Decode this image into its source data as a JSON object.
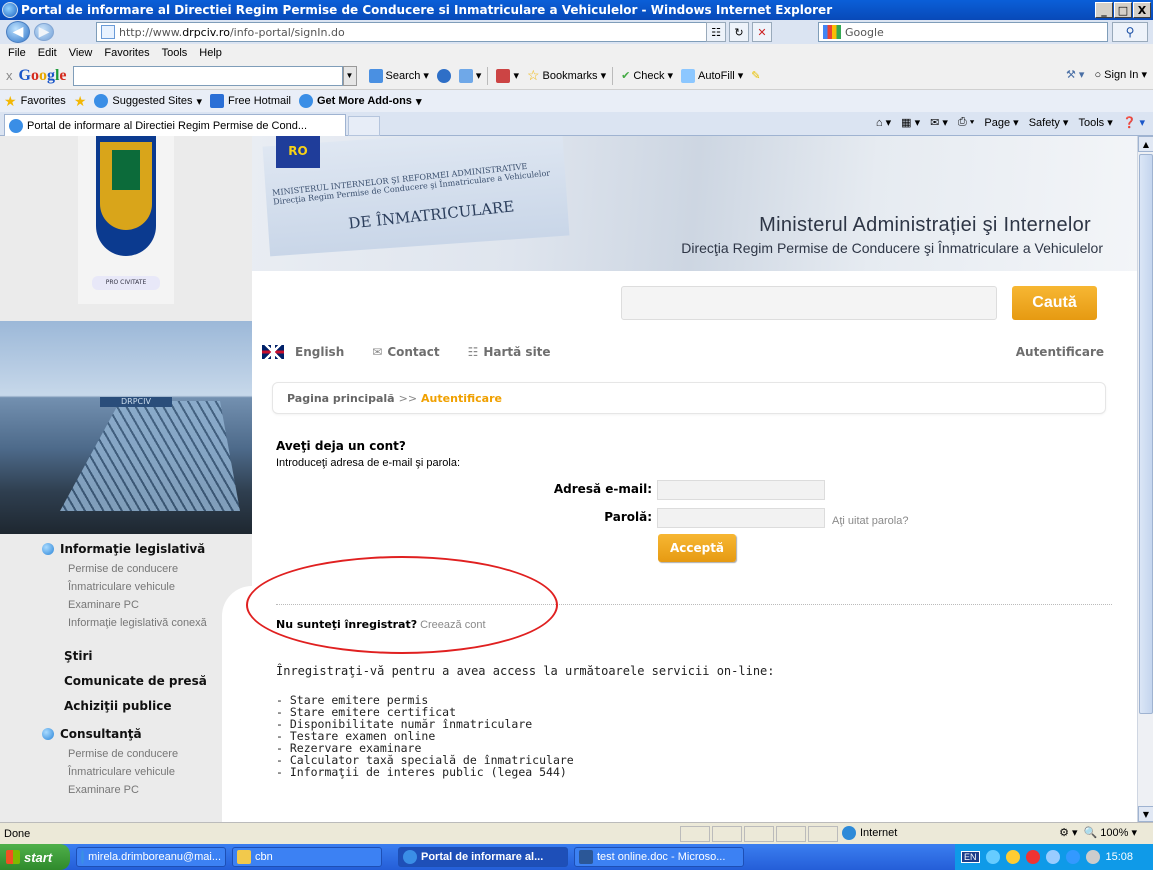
{
  "window": {
    "title": "Portal de informare al Directiei Regim Permise de Conducere si Inmatriculare a Vehiculelor - Windows Internet Explorer",
    "btn_min": "_",
    "btn_max": "□",
    "btn_close": "X"
  },
  "addressbar": {
    "url_prefix": "http://www.",
    "url_domain": "drpciv.ro",
    "url_path": "/info-portal/signIn.do",
    "search_placeholder": "Google"
  },
  "menubar": [
    "File",
    "Edit",
    "View",
    "Favorites",
    "Tools",
    "Help"
  ],
  "google_toolbar": {
    "close": "x",
    "logo": [
      "G",
      "o",
      "o",
      "g",
      "l",
      "e"
    ],
    "search": "Search",
    "bookmarks": "Bookmarks",
    "check": "Check",
    "autofill": "AutoFill",
    "sign_in": "Sign In"
  },
  "favorites_bar": {
    "favorites": "Favorites",
    "suggested": "Suggested Sites",
    "hotmail": "Free Hotmail",
    "addons": "Get More Add-ons"
  },
  "tab": {
    "label": "Portal de informare al Directiei Regim Permise de Cond...",
    "cmd": [
      "Page",
      "Safety",
      "Tools"
    ]
  },
  "header": {
    "ministry": "Ministerul Administrației şi Internelor",
    "direction": "Direcţia Regim Permise de Conducere şi Înmatriculare a Vehiculelor",
    "card_eu": "RO",
    "card_text": "MINISTERUL INTERNELOR ŞI REFORMEI ADMINISTRATIVE",
    "card_text2": "Direcţia Regim Permise de Conducere şi Înmatriculare a Vehiculelor",
    "card_title": "DE ÎNMATRICULARE",
    "crest_motto": "PRO CIVITATE",
    "building_sign": "DRPCIV"
  },
  "search": {
    "button": "Caută"
  },
  "toplinks": {
    "english": "English",
    "contact": "Contact",
    "sitemap": "Hartă site",
    "auth": "Autentificare"
  },
  "breadcrumb": {
    "home": "Pagina principală",
    "sep": ">>",
    "current": "Autentificare"
  },
  "login": {
    "title": "Aveţi deja un cont?",
    "subtitle": "Introduceţi adresa de e-mail şi parola:",
    "email_label": "Adresă e-mail:",
    "password_label": "Parolă:",
    "forgot": "Aţi uitat parola?",
    "submit": "Acceptă"
  },
  "register": {
    "question": "Nu sunteţi înregistrat?",
    "create": "Creează cont"
  },
  "intro": "Înregistraţi-vă pentru a avea access la următoarele servicii on-line:",
  "services": [
    "- Stare emitere permis",
    "- Stare emitere certificat",
    "- Disponibilitate număr înmatriculare",
    "- Testare examen online",
    "- Rezervare examinare",
    "- Calculator taxă specială de înmatriculare",
    "- Informaţii de interes public (legea 544)"
  ],
  "leftnav": {
    "legislative": "Informaţie legislativă",
    "legislative_items": [
      "Permise de conducere",
      "Înmatriculare vehicule",
      "Examinare PC",
      "Informaţie legislativă conexă"
    ],
    "news": "Ştiri",
    "press": "Comunicate de presă",
    "procurement": "Achiziţii publice",
    "consulting": "Consultanţă",
    "consulting_items": [
      "Permise de conducere",
      "Înmatriculare vehicule",
      "Examinare PC"
    ]
  },
  "statusbar": {
    "status": "Done",
    "zone": "Internet",
    "zoom": "100%"
  },
  "taskbar": {
    "start": "start",
    "items": [
      "mirela.drimboreanu@mai...",
      "cbn",
      "Portal de informare al...",
      "test online.doc - Microso..."
    ],
    "lang": "EN",
    "clock": "15:08"
  },
  "colors": {
    "accent": "#f0a000",
    "title_blue": "#0a5fd8",
    "annotation": "#e02020"
  }
}
